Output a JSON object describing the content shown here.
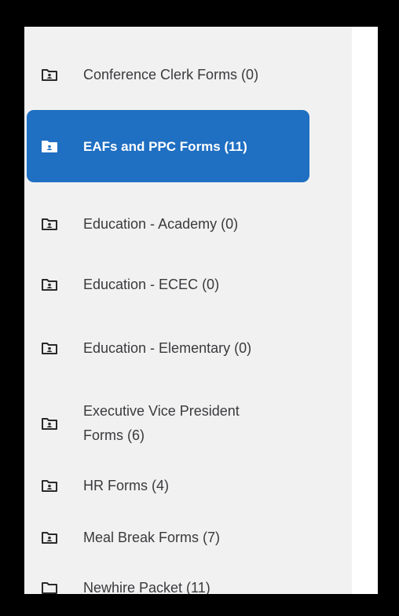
{
  "folders": [
    {
      "label": "Conference Clerk Forms (0)",
      "icon": "folder-user-icon",
      "active": false
    },
    {
      "label": "EAFs and PPC Forms (11)",
      "icon": "folder-user-icon",
      "active": true
    },
    {
      "label": "Education - Academy (0)",
      "icon": "folder-user-icon",
      "active": false
    },
    {
      "label": "Education - ECEC (0)",
      "icon": "folder-user-icon",
      "active": false
    },
    {
      "label": "Education - Elementary (0)",
      "icon": "folder-user-icon",
      "active": false
    },
    {
      "label": "Executive Vice President Forms (6)",
      "icon": "folder-user-icon",
      "active": false
    },
    {
      "label": "HR Forms (4)",
      "icon": "folder-user-icon",
      "active": false
    },
    {
      "label": "Meal Break Forms (7)",
      "icon": "folder-user-icon",
      "active": false
    },
    {
      "label": "Newhire Packet (11)",
      "icon": "folder-icon",
      "active": false
    }
  ],
  "colors": {
    "active_bg": "#1f6fc2",
    "sidebar_bg": "#f1f1f2",
    "text": "#3a3a3c",
    "active_text": "#ffffff"
  }
}
